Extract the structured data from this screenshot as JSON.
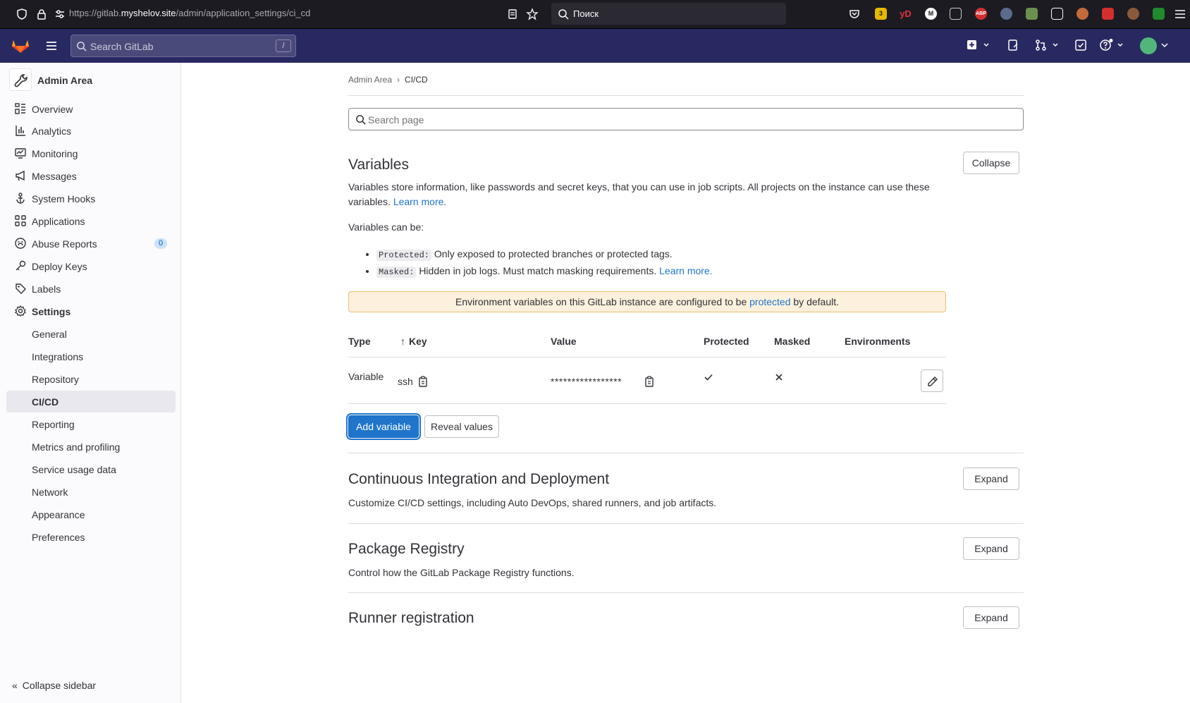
{
  "browser": {
    "url_prefix": "https://gitlab.",
    "url_domain": "myshelov.site",
    "url_path": "/admin/application_settings/ci_cd",
    "search_placeholder": "Поиск",
    "ext_badge": "3",
    "ext_yd": "yD",
    "ext_m": "M",
    "ext_abp": "ABP"
  },
  "topbar": {
    "search_placeholder": "Search GitLab",
    "search_shortcut": "/"
  },
  "sidebar": {
    "header": "Admin Area",
    "items": [
      {
        "label": "Overview",
        "icon": "overview-icon"
      },
      {
        "label": "Analytics",
        "icon": "chart-icon"
      },
      {
        "label": "Monitoring",
        "icon": "monitor-icon"
      },
      {
        "label": "Messages",
        "icon": "bullhorn-icon"
      },
      {
        "label": "System Hooks",
        "icon": "hook-icon"
      },
      {
        "label": "Applications",
        "icon": "applications-icon"
      },
      {
        "label": "Abuse Reports",
        "icon": "abuse-icon",
        "badge": "0"
      },
      {
        "label": "Deploy Keys",
        "icon": "key-icon"
      },
      {
        "label": "Labels",
        "icon": "label-icon"
      },
      {
        "label": "Settings",
        "icon": "settings-icon"
      }
    ],
    "sub_items": [
      {
        "label": "General"
      },
      {
        "label": "Integrations"
      },
      {
        "label": "Repository"
      },
      {
        "label": "CI/CD",
        "active": true
      },
      {
        "label": "Reporting"
      },
      {
        "label": "Metrics and profiling"
      },
      {
        "label": "Service usage data"
      },
      {
        "label": "Network"
      },
      {
        "label": "Appearance"
      },
      {
        "label": "Preferences"
      }
    ],
    "collapse_label": "Collapse sidebar"
  },
  "breadcrumb": {
    "root": "Admin Area",
    "current": "CI/CD"
  },
  "page_search": {
    "placeholder": "Search page"
  },
  "variables": {
    "title": "Variables",
    "collapse_label": "Collapse",
    "description": "Variables store information, like passwords and secret keys, that you can use in job scripts. All projects on the instance can use these variables.",
    "learn_more": "Learn more.",
    "can_be": "Variables can be:",
    "protected_code": "Protected:",
    "protected_text": "Only exposed to protected branches or protected tags.",
    "masked_code": "Masked:",
    "masked_text": "Hidden in job logs. Must match masking requirements.",
    "alert_before": "Environment variables on this GitLab instance are configured to be",
    "alert_link": "protected",
    "alert_after": "by default.",
    "columns": {
      "type": "Type",
      "key": "Key",
      "value": "Value",
      "protected": "Protected",
      "masked": "Masked",
      "environments": "Environments"
    },
    "rows": [
      {
        "type": "Variable",
        "key": "ssh",
        "value": "*****************",
        "protected": true,
        "masked": false
      }
    ],
    "add_label": "Add variable",
    "reveal_label": "Reveal values"
  },
  "sections": [
    {
      "title": "Continuous Integration and Deployment",
      "description": "Customize CI/CD settings, including Auto DevOps, shared runners, and job artifacts.",
      "button": "Expand"
    },
    {
      "title": "Package Registry",
      "description": "Control how the GitLab Package Registry functions.",
      "button": "Expand"
    },
    {
      "title": "Runner registration",
      "description": "",
      "button": "Expand"
    }
  ],
  "colors": {
    "topbar": "#292961",
    "primary": "#1f75cb",
    "alert_bg": "#fdf1dd",
    "browser_chrome": "#1c1b22"
  }
}
